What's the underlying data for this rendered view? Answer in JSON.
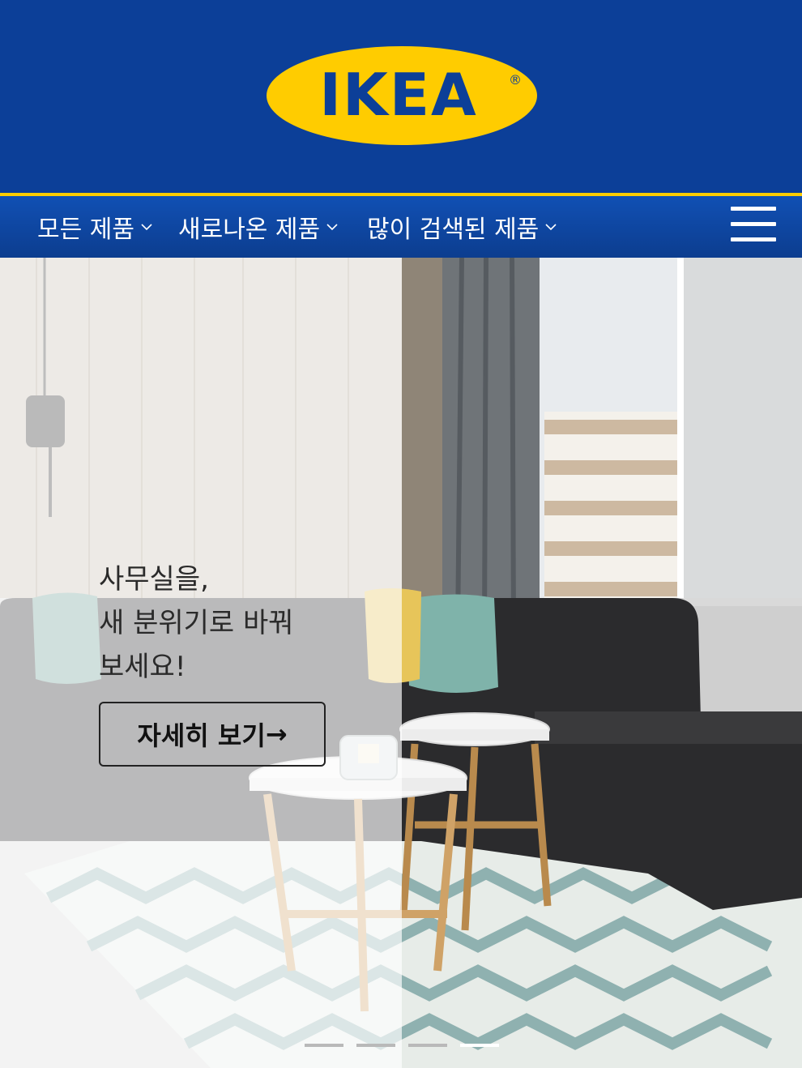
{
  "header": {
    "logo_text": "IKEA",
    "registered_mark": "®",
    "colors": {
      "blue": "#0c3f98",
      "yellow": "#ffcc00"
    }
  },
  "nav": {
    "items": [
      {
        "label": "모든 제품"
      },
      {
        "label": "새로나온 제품"
      },
      {
        "label": "많이 검색된 제품"
      }
    ],
    "menu_icon": "hamburger-icon"
  },
  "hero": {
    "lines": [
      "사무실을,",
      "새 분위기로 바꿔",
      "보세요!"
    ],
    "cta_label": "자세히 보기",
    "cta_arrow": "→",
    "slides": {
      "count": 4,
      "active": 4
    }
  }
}
